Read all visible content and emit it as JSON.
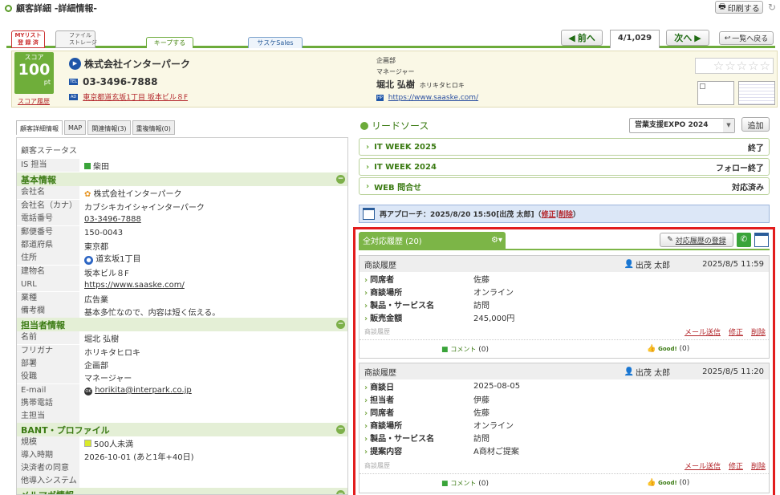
{
  "header": {
    "title": "顧客詳細 -詳細情報-",
    "print": "印刷する"
  },
  "toolbar": {
    "mylist": "MYリスト\n登 録 済",
    "file_storage": "ファイル\nストレージ",
    "keep": "キープする",
    "saaske": "サスケSales",
    "prev": "前へ",
    "counter": "4/1,029",
    "next": "次へ",
    "back": "一覧へ戻る"
  },
  "customer": {
    "score_label": "スコア",
    "score": "100",
    "score_unit": "pt",
    "score_history": "スコア履歴",
    "company": "株式会社インターパーク",
    "tel": "03-3496-7888",
    "address": "東京都道玄坂1丁目 坂本ビル８F",
    "dept": "企画部",
    "position": "マネージャー",
    "name": "堀北 弘樹",
    "name_kana": "ホリキタヒロキ",
    "hp": "https://www.saaske.com/",
    "tel_badge": "TEL",
    "ad_badge": "AD",
    "hp_badge": "HP"
  },
  "tabs": [
    "顧客詳細情報",
    "MAP",
    "関連情報(3)",
    "重複情報(0)"
  ],
  "detail": {
    "status": {
      "label": "顧客ステータス",
      "value": ""
    },
    "is": {
      "label": "IS 担当",
      "value": "柴田"
    },
    "basic": {
      "title": "基本情報",
      "rows": [
        {
          "k": "会社名",
          "v": "株式会社インターパーク"
        },
        {
          "k": "会社名（カナ）",
          "v": "カブシキカイシャインターパーク"
        },
        {
          "k": "電話番号",
          "v": "03-3496-7888"
        },
        {
          "k": "郵便番号",
          "v": "150-0043"
        },
        {
          "k": "都道府県",
          "v": "東京都"
        },
        {
          "k": "住所",
          "v": "道玄坂1丁目"
        },
        {
          "k": "建物名",
          "v": "坂本ビル８F"
        },
        {
          "k": "URL",
          "v": "https://www.saaske.com/"
        },
        {
          "k": "業種",
          "v": "広告業"
        },
        {
          "k": "備考欄",
          "v": "基本多忙なので、内容は短く伝える。"
        }
      ]
    },
    "contact": {
      "title": "担当者情報",
      "rows": [
        {
          "k": "名前",
          "v": "堀北 弘樹"
        },
        {
          "k": "フリガナ",
          "v": "ホリキタヒロキ"
        },
        {
          "k": "部署",
          "v": "企画部"
        },
        {
          "k": "役職",
          "v": "マネージャー"
        },
        {
          "k": "E-mail",
          "v": "horikita@interpark.co.jp"
        },
        {
          "k": "携帯電話",
          "v": ""
        },
        {
          "k": "主担当",
          "v": ""
        }
      ]
    },
    "bant": {
      "title": "BANT・プロファイル",
      "rows": [
        {
          "k": "規模",
          "v": "500人未満"
        },
        {
          "k": "導入時期",
          "v": "2026-10-01 (あと1年+40日)"
        },
        {
          "k": "決済者の同意",
          "v": ""
        },
        {
          "k": "他導入システム",
          "v": ""
        }
      ]
    },
    "mail_title": "メルマガ情報"
  },
  "leads": {
    "title": "リードソース",
    "select": "営業支援EXPO 2024",
    "add": "追加",
    "items": [
      {
        "name": "IT WEEK 2025",
        "status": "終了"
      },
      {
        "name": "IT WEEK 2024",
        "status": "フォロー終了"
      },
      {
        "name": "WEB 問合せ",
        "status": "対応済み"
      }
    ]
  },
  "reapproach": {
    "text": "再アプローチ：2025/8/20 15:50[出茂 太郎]（",
    "edit": "修正",
    "sep": " | ",
    "del": "削除",
    "close": "）"
  },
  "history": {
    "tab": "全対応履歴 (20)",
    "register": "対応履歴の登録",
    "cards": [
      {
        "type": "商談履歴",
        "user": "出茂 太郎",
        "date": "2025/8/5 11:59",
        "rows": [
          {
            "k": "同席者",
            "v": "佐藤"
          },
          {
            "k": "商談場所",
            "v": "オンライン"
          },
          {
            "k": "製品・サービス名",
            "v": "訪問"
          },
          {
            "k": "販売金額",
            "v": "245,000円"
          }
        ],
        "sub": "商談履歴",
        "mail": "メール送信",
        "edit": "修正",
        "del": "削除",
        "comment": "コメント",
        "comment_count": "(0)",
        "good": "Good!",
        "good_count": "(0)"
      },
      {
        "type": "商談履歴",
        "user": "出茂 太郎",
        "date": "2025/8/5 11:20",
        "rows": [
          {
            "k": "商談日",
            "v": "2025-08-05"
          },
          {
            "k": "担当者",
            "v": "伊藤"
          },
          {
            "k": "同席者",
            "v": "佐藤"
          },
          {
            "k": "商談場所",
            "v": "オンライン"
          },
          {
            "k": "製品・サービス名",
            "v": "訪問"
          },
          {
            "k": "提案内容",
            "v": "A商材ご提案"
          }
        ],
        "sub": "商談履歴",
        "mail": "メール送信",
        "edit": "修正",
        "del": "削除",
        "comment": "コメント",
        "comment_count": "(0)",
        "good": "Good!",
        "good_count": "(0)"
      }
    ]
  }
}
